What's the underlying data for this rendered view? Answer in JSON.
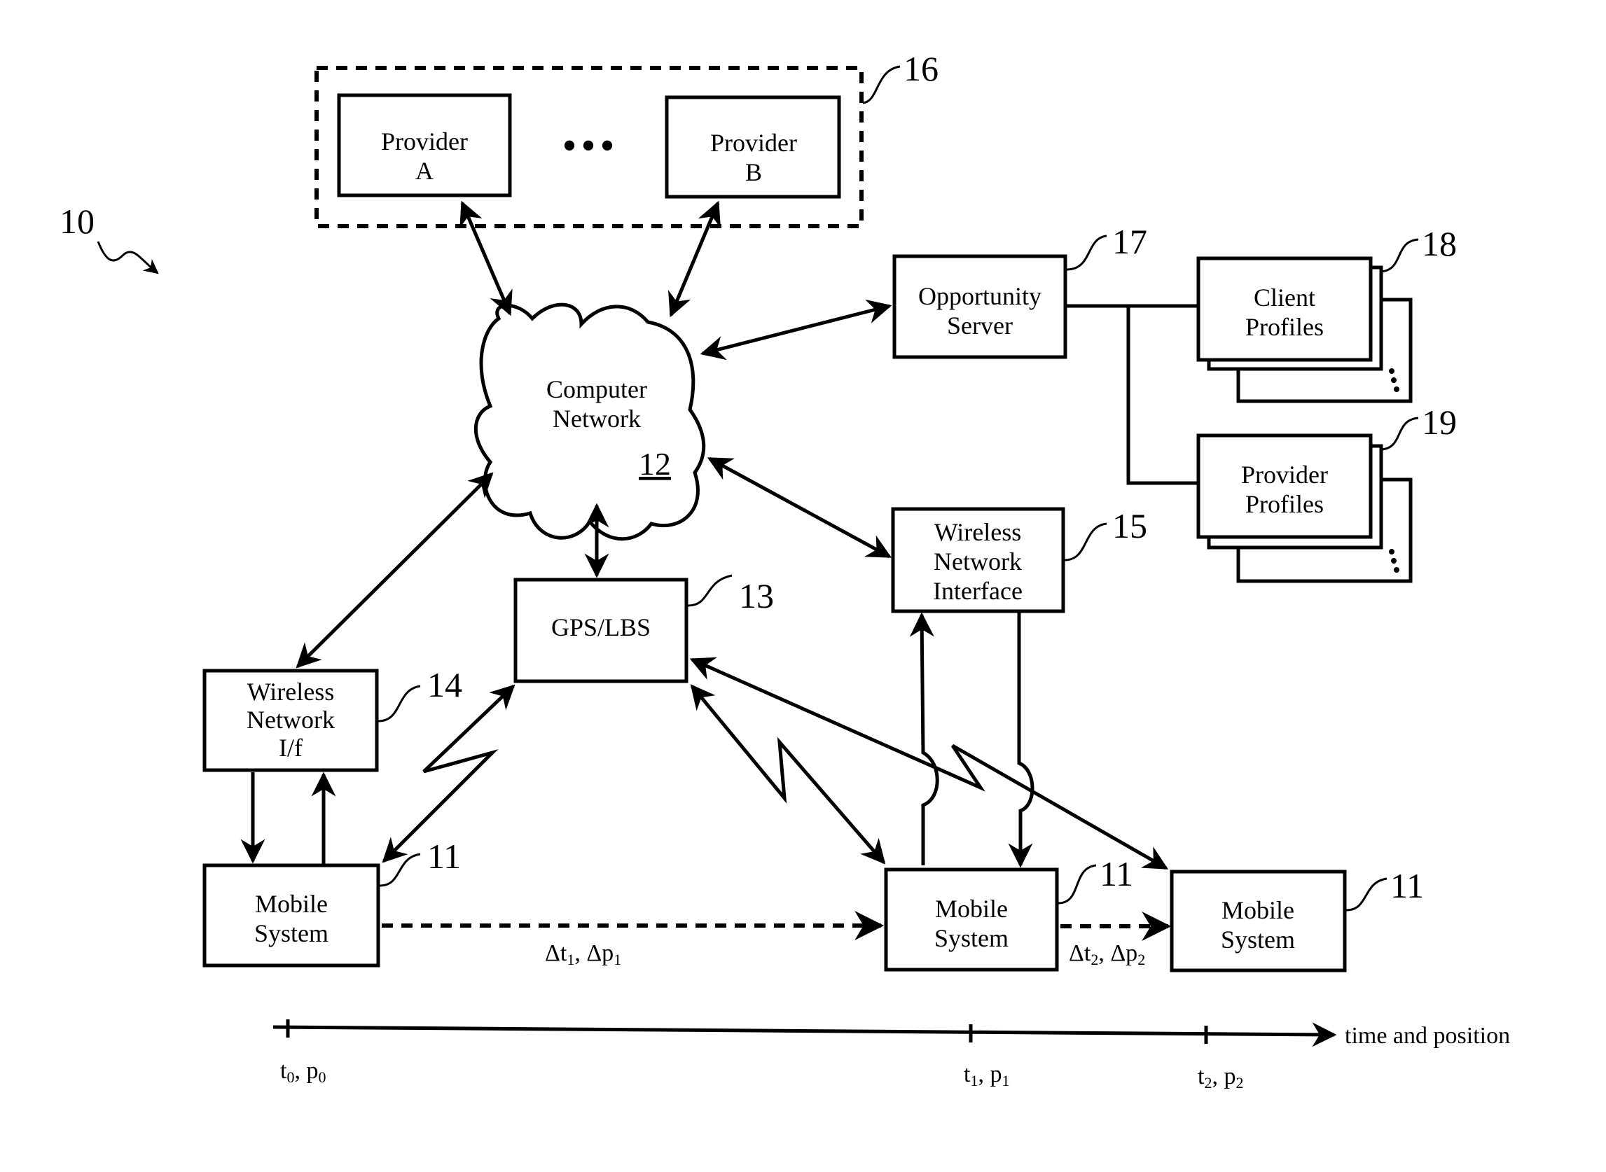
{
  "figure_ref": "10",
  "providers_group": {
    "ref": "16",
    "provider_a": [
      "Provider",
      "A"
    ],
    "provider_b": [
      "Provider",
      "B"
    ],
    "ellipsis": "•••"
  },
  "computer_network": {
    "lines": [
      "Computer",
      "Network"
    ],
    "ref": "12"
  },
  "opportunity_server": {
    "lines": [
      "Opportunity",
      "Server"
    ],
    "ref": "17"
  },
  "client_profiles": {
    "lines": [
      "Client",
      "Profiles"
    ],
    "ref": "18"
  },
  "provider_profiles": {
    "lines": [
      "Provider",
      "Profiles"
    ],
    "ref": "19"
  },
  "wireless_network_interface": {
    "lines": [
      "Wireless",
      "Network",
      "Interface"
    ],
    "ref": "15"
  },
  "gps_lbs": {
    "label": "GPS/LBS",
    "ref": "13"
  },
  "wireless_network_if": {
    "lines": [
      "Wireless",
      "Network",
      "I/f"
    ],
    "ref": "14"
  },
  "mobile_systems": [
    {
      "lines": [
        "Mobile",
        "System"
      ],
      "ref": "11"
    },
    {
      "lines": [
        "Mobile",
        "System"
      ],
      "ref": "11"
    },
    {
      "lines": [
        "Mobile",
        "System"
      ],
      "ref": "11"
    }
  ],
  "transitions": [
    {
      "dt": "Δt",
      "dt_sub": "1",
      "dp": "Δp",
      "dp_sub": "1"
    },
    {
      "dt": "Δt",
      "dt_sub": "2",
      "dp": "Δp",
      "dp_sub": "2"
    }
  ],
  "timeline": {
    "label": "time and position",
    "ticks": [
      {
        "t": "t",
        "p": "p",
        "sub": "0"
      },
      {
        "t": "t",
        "p": "p",
        "sub": "1"
      },
      {
        "t": "t",
        "p": "p",
        "sub": "2"
      }
    ]
  }
}
